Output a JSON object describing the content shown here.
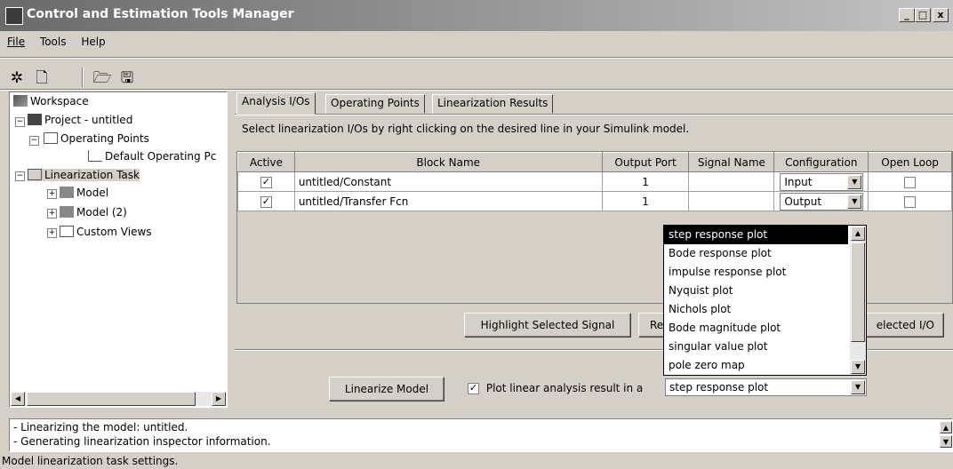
{
  "window": {
    "title": "Control and Estimation Tools Manager",
    "min_label": "_",
    "max_label": "□",
    "close_label": "x"
  },
  "menu": [
    "File",
    "Tools",
    "Help"
  ],
  "toolbar": {
    "icons": [
      "new-task-icon",
      "new-project-icon",
      "open-icon",
      "save-icon"
    ]
  },
  "tree": {
    "workspace": "Workspace",
    "project": "Project - untitled",
    "operating_points": "Operating Points",
    "default_op": "Default Operating Pc",
    "linearization_task": "Linearization Task",
    "model": "Model",
    "model2": "Model (2)",
    "custom_views": "Custom Views"
  },
  "tabs": [
    "Analysis I/Os",
    "Operating Points",
    "Linearization Results"
  ],
  "instructions": "Select linearization I/Os by right clicking on the desired line in your Simulink model.",
  "table": {
    "headers": [
      "Active",
      "Block Name",
      "Output Port",
      "Signal Name",
      "Configuration",
      "Open Loop"
    ],
    "rows": [
      {
        "active": "✓",
        "block": "untitled/Constant",
        "port": "1",
        "signal": "",
        "config": "Input",
        "open_loop": ""
      },
      {
        "active": "✓",
        "block": "untitled/Transfer Fcn",
        "port": "1",
        "signal": "",
        "config": "Output",
        "open_loop": ""
      }
    ]
  },
  "buttons": {
    "highlight": "Highlight Selected Signal",
    "remove_partial": "Re",
    "selected_io_partial": "elected I/O",
    "linearize": "Linearize Model"
  },
  "plot_checkbox": {
    "checked": "✓",
    "label": "Plot linear analysis result in a"
  },
  "plot_combo": {
    "value": "step response plot",
    "options": [
      "step response plot",
      "Bode response plot",
      "impulse response plot",
      "Nyquist plot",
      "Nichols plot",
      "Bode magnitude plot",
      "singular value plot",
      "pole zero map"
    ]
  },
  "log": [
    "- Linearizing the model: untitled.",
    "- Generating linearization inspector information."
  ],
  "status": "Model linearization task settings."
}
